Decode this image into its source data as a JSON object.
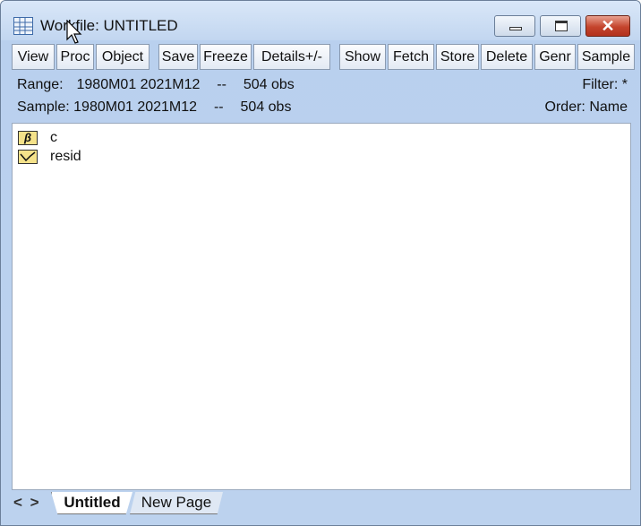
{
  "window": {
    "title": "Workfile: UNTITLED",
    "icon": "workfile-grid-icon"
  },
  "toolbar": {
    "buttons": [
      "View",
      "Proc",
      "Object",
      "Save",
      "Freeze",
      "Details+/-",
      "Show",
      "Fetch",
      "Store",
      "Delete",
      "Genr",
      "Sample"
    ]
  },
  "info": {
    "range_label": "Range:",
    "range_value": "1980M01 2021M12",
    "range_sep": "--",
    "range_obs": "504 obs",
    "sample_label": "Sample:",
    "sample_value": "1980M01 2021M12",
    "sample_sep": "--",
    "sample_obs": "504 obs",
    "filter": "Filter: *",
    "order": "Order: Name"
  },
  "objects": [
    {
      "icon": "coefficient-vector-icon",
      "icon_glyph": "β",
      "name": "c"
    },
    {
      "icon": "series-icon",
      "icon_glyph": "",
      "name": "resid"
    }
  ],
  "tabs": {
    "nav": "< >",
    "pages": [
      "Untitled",
      "New Page"
    ],
    "active": "Untitled"
  }
}
